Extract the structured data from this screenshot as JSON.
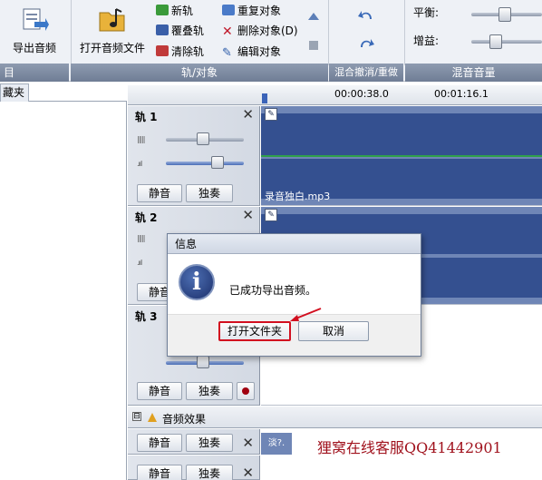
{
  "ribbon": {
    "export_audio_label": "导出音频",
    "open_audio_file_label": "打开音频文件",
    "new_track_label": "新轨",
    "overlay_track_label": "覆叠轨",
    "clear_track_label": "清除轨",
    "repeat_object_label": "重复对象",
    "delete_object_label": "删除对象(D)",
    "edit_object_label": "编辑对象",
    "pan_label": "平衡:",
    "gain_label": "增益:",
    "groups": {
      "left_partial": "目",
      "tracks_objects": "轨/对象",
      "undo_redo": "混合撤消/重做",
      "mix_volume": "混音音量"
    }
  },
  "browser": {
    "tab_label": "藏夹"
  },
  "timeline": {
    "time_marks": [
      "00:00:38.0",
      "00:01:16.1"
    ]
  },
  "tracks": [
    {
      "title": "轨 1",
      "mute_label": "静音",
      "solo_label": "独奏",
      "clip_name": "录音独白.mp3"
    },
    {
      "title": "轨 2",
      "mute_label": "静音"
    },
    {
      "title": "轨 3",
      "mute_label": "静音",
      "solo_label": "独奏"
    }
  ],
  "effects_row": {
    "label": "音频效果",
    "expander": "⊟"
  },
  "bottom_rows": [
    {
      "mute_label": "静音",
      "solo_label": "独奏",
      "clip_text": "淡?."
    },
    {
      "mute_label": "静音",
      "solo_label": "独奏"
    }
  ],
  "watermark_text": "狸窝在线客服QQ41442901",
  "dialog": {
    "title": "信息",
    "icon_glyph": "i",
    "message": "已成功导出音频。",
    "open_folder_label": "打开文件夹",
    "cancel_label": "取消"
  },
  "colors": {
    "waveform": "#2e4a8c",
    "clip_bg": "#6f86b6",
    "highlight_red": "#d20f1f",
    "group_bar": "#7a879e"
  }
}
